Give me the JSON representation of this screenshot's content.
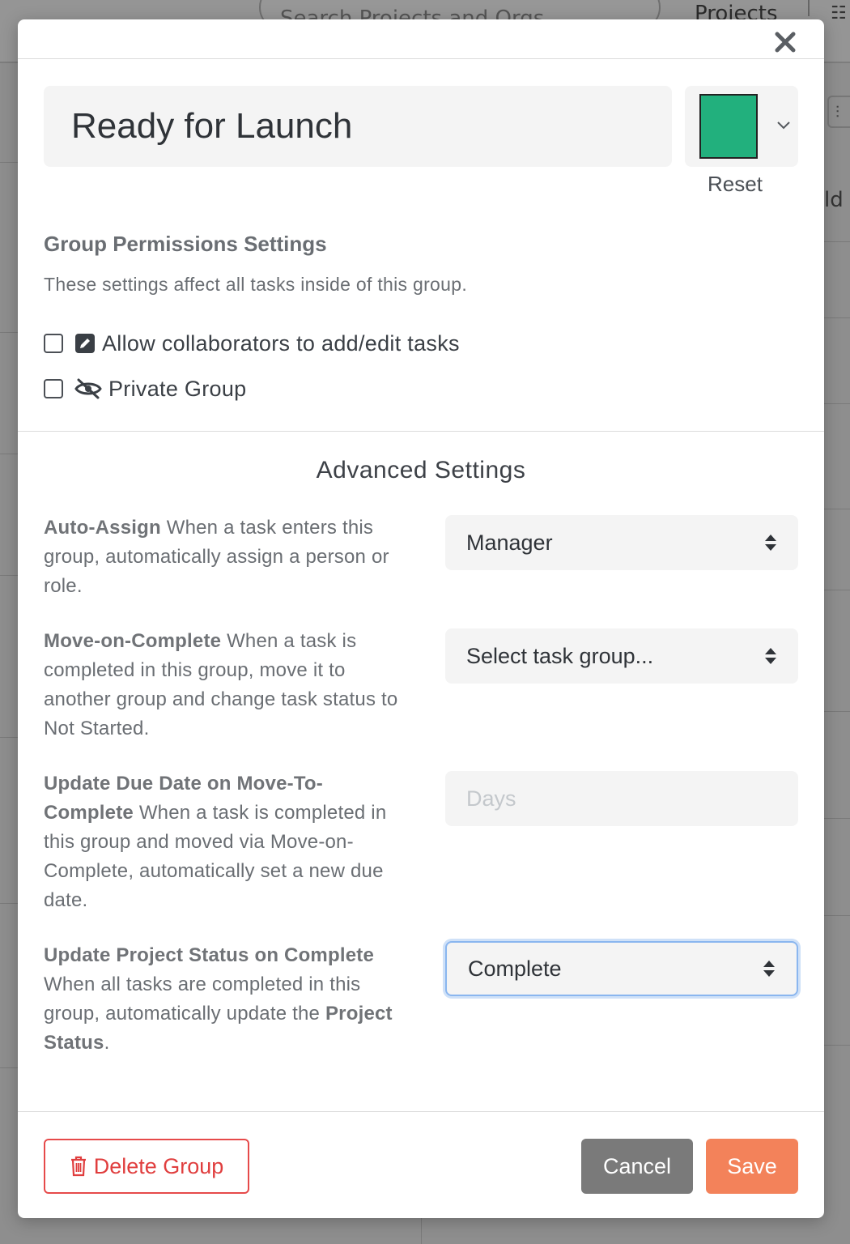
{
  "background": {
    "search_placeholder": "Search Projects and Orgs",
    "projects_label": "Projects",
    "partial_text": "ld"
  },
  "modal": {
    "group_name": "Ready for Launch",
    "group_color": "#22b07d",
    "reset_label": "Reset",
    "permissions": {
      "title": "Group Permissions Settings",
      "description": "These settings affect all tasks inside of this group.",
      "allow_collaborators_label": "Allow collaborators to add/edit tasks",
      "allow_collaborators_checked": false,
      "private_group_label": "Private Group",
      "private_group_checked": false
    },
    "advanced": {
      "title": "Advanced Settings",
      "auto_assign": {
        "label": "Auto-Assign",
        "description": " When a task enters this group, automatically assign a person or role.",
        "value": "Manager"
      },
      "move_on_complete": {
        "label": "Move-on-Complete",
        "description": " When a task is completed in this group, move it to another group and change task status to Not Started.",
        "value": "Select task group..."
      },
      "update_due_date": {
        "label": "Update Due Date on Move-To-Complete",
        "description": " When a task is completed in this group and moved via Move-on-Complete, automatically set a new due date.",
        "placeholder": "Days"
      },
      "update_project_status": {
        "label": "Update Project Status on Complete",
        "description_1": " When all tasks are completed in this group, automatically update the ",
        "description_bold": "Project Status",
        "description_2": ".",
        "value": "Complete"
      }
    },
    "footer": {
      "delete_label": "Delete Group",
      "cancel_label": "Cancel",
      "save_label": "Save"
    }
  },
  "colors": {
    "save": "#f3825a",
    "cancel": "#7a7a7a",
    "delete": "#e03e3e",
    "focus": "#8ab6ef"
  }
}
